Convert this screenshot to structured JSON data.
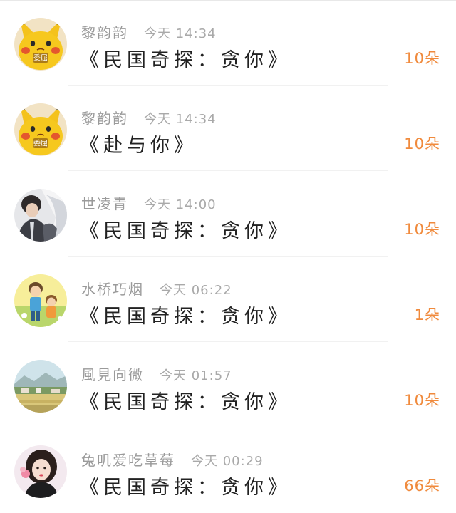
{
  "colors": {
    "name": "#9a9a9a",
    "time": "#a9a9a9",
    "title": "#222222",
    "count": "#f08a3c",
    "divider": "#f1f1f1"
  },
  "records": [
    {
      "user": "黎韵韵",
      "time": "今天 14:34",
      "title": "《民国奇探：贪你》",
      "count": "10朵",
      "avatar": "pikachu-sticker",
      "avatar_text": "委屈"
    },
    {
      "user": "黎韵韵",
      "time": "今天 14:34",
      "title": "《赴与你》",
      "count": "10朵",
      "avatar": "pikachu-sticker",
      "avatar_text": "委屈"
    },
    {
      "user": "世凌青",
      "time": "今天 14:00",
      "title": "《民国奇探：贪你》",
      "count": "10朵",
      "avatar": "couple-photo"
    },
    {
      "user": "水桥巧烟",
      "time": "今天 06:22",
      "title": "《民国奇探：贪你》",
      "count": "1朵",
      "avatar": "cartoon-kids"
    },
    {
      "user": "風見向微",
      "time": "今天 01:57",
      "title": "《民国奇探：贪你》",
      "count": "10朵",
      "avatar": "landscape"
    },
    {
      "user": "兔叽爱吃草莓",
      "time": "今天 00:29",
      "title": "《民国奇探：贪你》",
      "count": "66朵",
      "avatar": "girl-portrait"
    }
  ]
}
